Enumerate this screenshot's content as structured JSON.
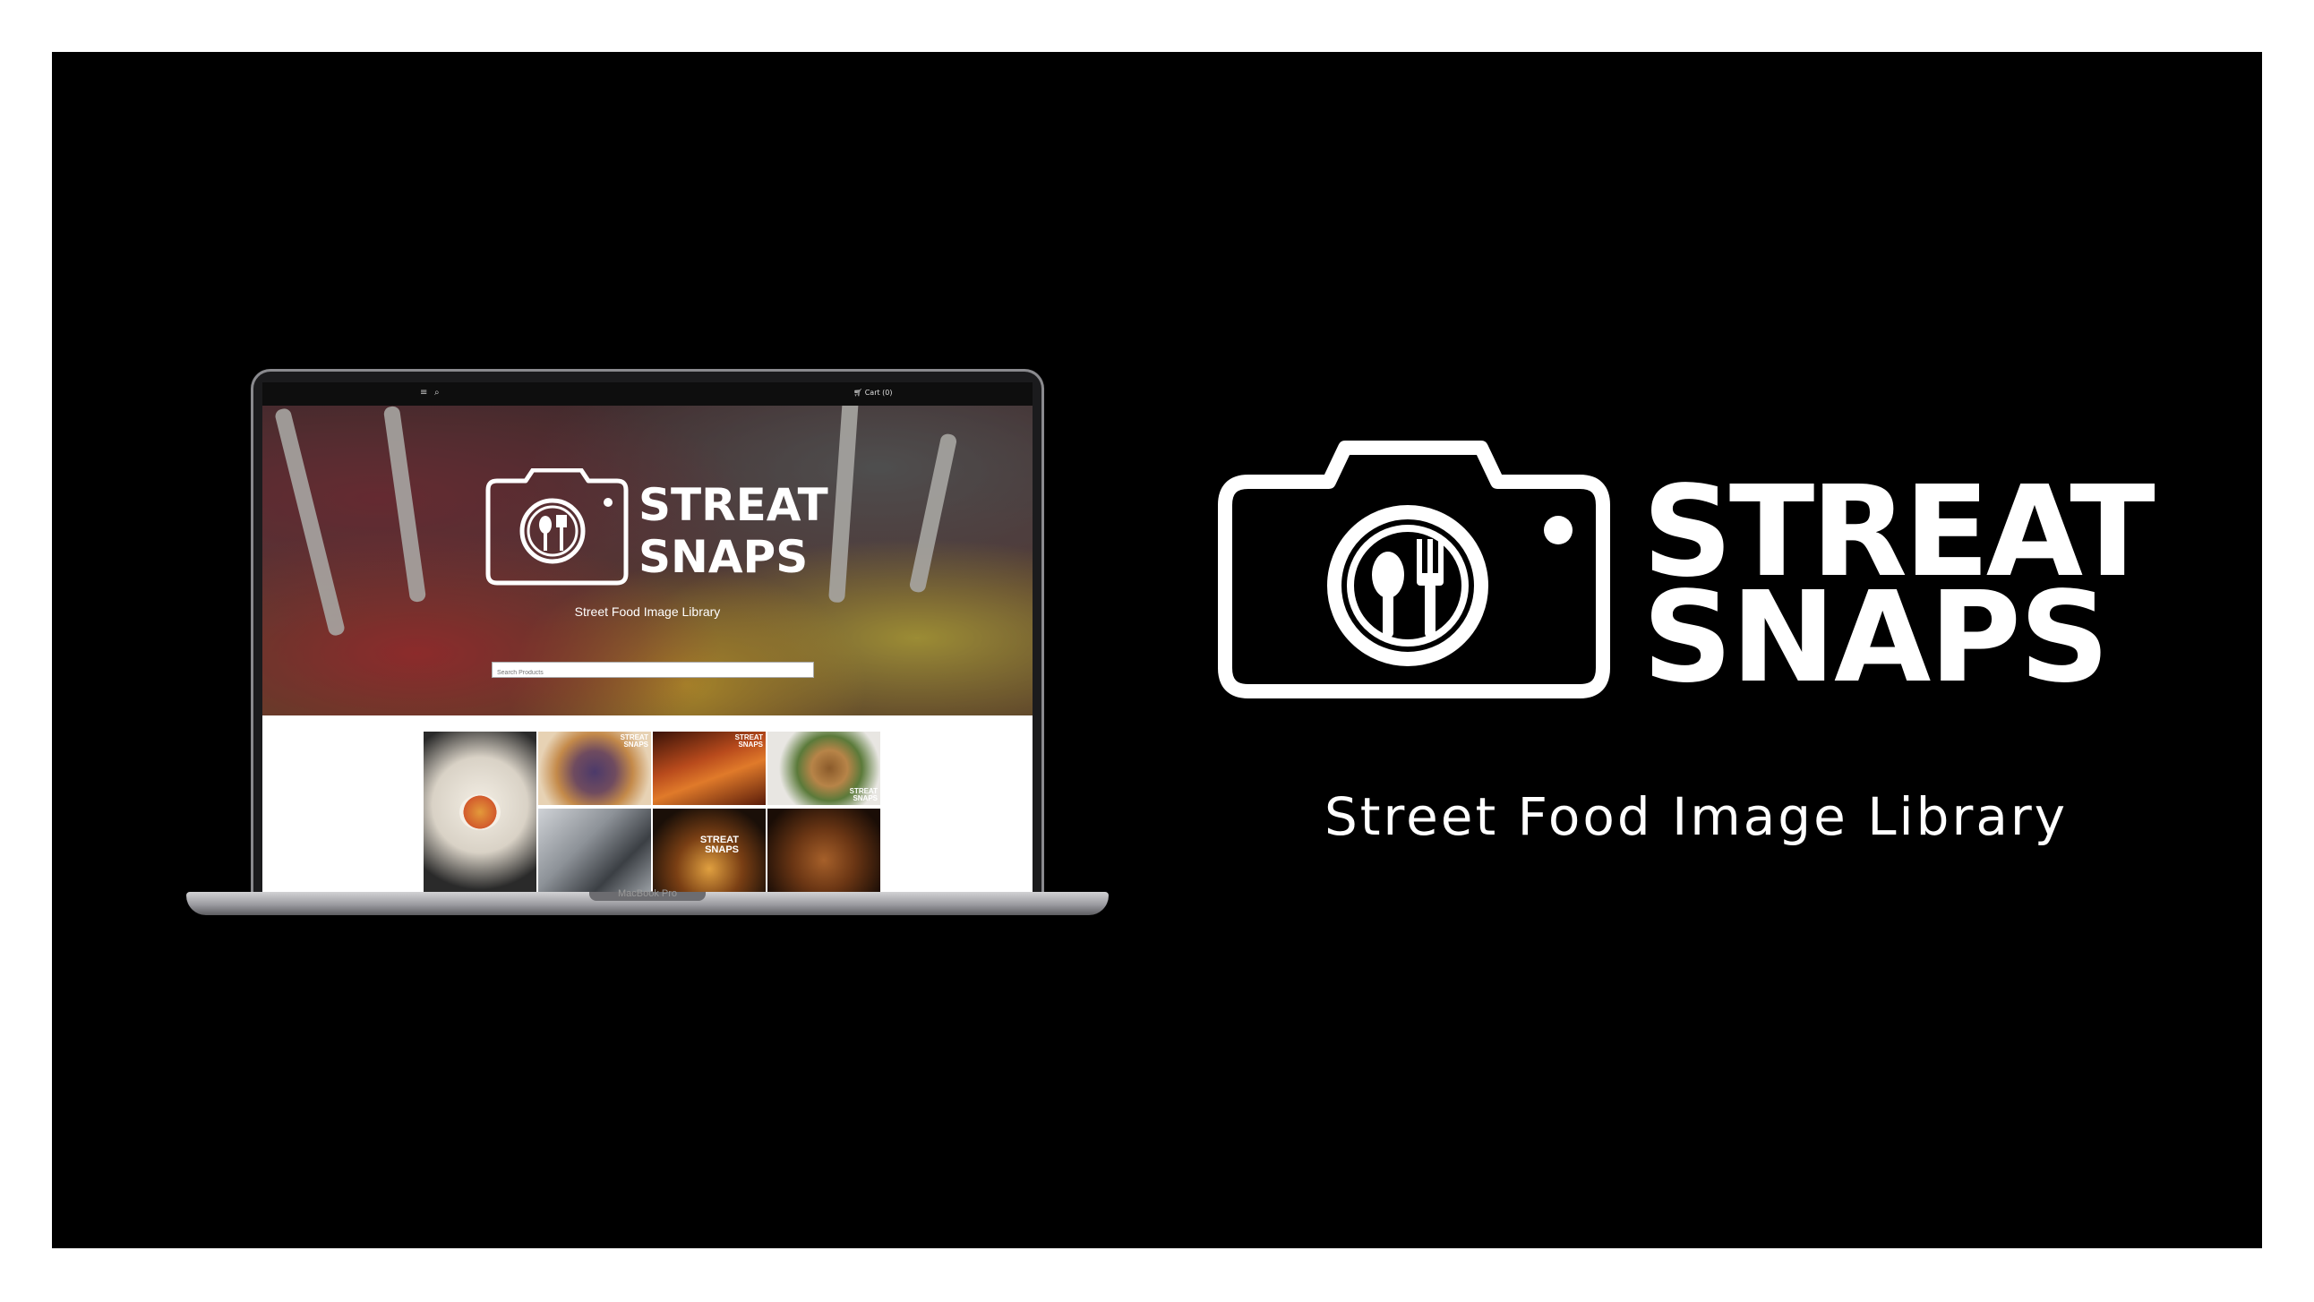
{
  "laptop": {
    "model_label": "MacBook Pro"
  },
  "site": {
    "topbar": {
      "menu_icon": "hamburger-icon",
      "search_icon": "search-icon",
      "cart_label": "Cart (0)"
    },
    "hero": {
      "logo_line1": "STREAT",
      "logo_line2": "SNAPS",
      "subtitle": "Street Food Image Library",
      "search_placeholder": "Search Products"
    },
    "gallery": {
      "watermark_line1": "STREAT",
      "watermark_line2": "SNAPS"
    }
  },
  "brand": {
    "logo_line1": "STREAT",
    "logo_line2": "SNAPS",
    "subtitle": "Street Food Image Library",
    "color": "#ffffff",
    "background": "#000000"
  }
}
